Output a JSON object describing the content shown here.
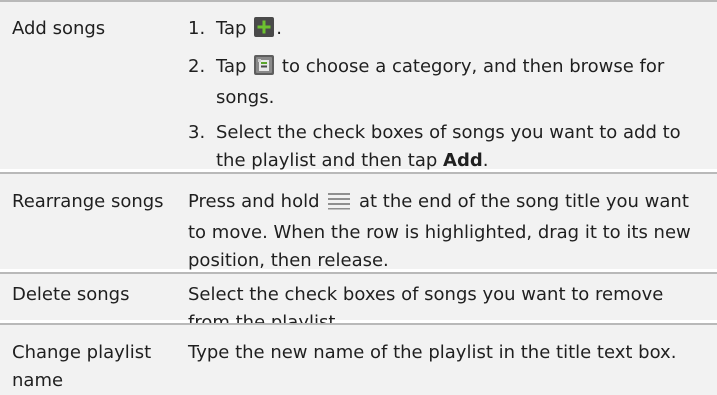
{
  "rows": [
    {
      "label": "Add songs",
      "steps": [
        {
          "num": "1.",
          "before": "Tap ",
          "icon": "plus-icon",
          "after": "."
        },
        {
          "num": "2.",
          "before": "Tap ",
          "icon": "category-icon",
          "after": " to choose a category, and then browse for songs."
        },
        {
          "num": "3.",
          "before": "Select the check boxes of songs you want to add to the playlist and then tap ",
          "bold": "Add",
          "after": "."
        }
      ]
    },
    {
      "label": "Rearrange songs",
      "text_before": "Press and hold ",
      "icon": "drag-handle-icon",
      "text_after": " at the end of the song title you want to move. When the row is highlighted, drag it to its new position, then release."
    },
    {
      "label": "Delete songs",
      "text": "Select the check boxes of songs you want to remove from the playlist."
    },
    {
      "label": "Change playlist name",
      "text": "Type the new name of the playlist in the title text box."
    }
  ],
  "colors": {
    "row_background": "#f2f2f2",
    "divider": "#b9b9b9",
    "text": "#1f1f1f",
    "icon_green": "#5aa52a"
  }
}
